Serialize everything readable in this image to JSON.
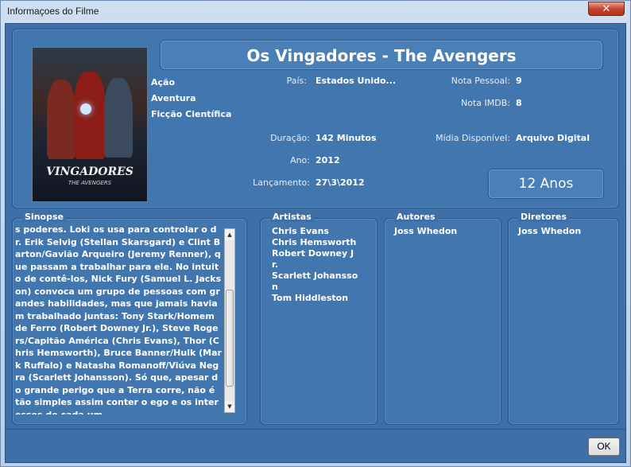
{
  "window": {
    "title": "Informaçoes do Filme",
    "close_glyph": "✕"
  },
  "poster": {
    "title": "VINGADORES",
    "subtitle": "THE AVENGERS"
  },
  "movie": {
    "title": "Os Vingadores - The Avengers"
  },
  "genres": [
    "Ação",
    "Aventura",
    "Ficção Científica"
  ],
  "info": {
    "pais_label": "País:",
    "pais_value": "Estados Unido...",
    "nota_pessoal_label": "Nota Pessoal:",
    "nota_pessoal_value": "9",
    "nota_imdb_label": "Nota IMDB:",
    "nota_imdb_value": "8",
    "duracao_label": "Duração:",
    "duracao_value": "142 Minutos",
    "midia_label": "Mídia Disponível:",
    "midia_value": "Arquivo Digital",
    "ano_label": "Ano:",
    "ano_value": "2012",
    "lancamento_label": "Lançamento:",
    "lancamento_value": "27\\3\\2012",
    "classificacao": "12 Anos"
  },
  "sinopse": {
    "label": "Sinopse",
    "text": "s poderes. Loki os usa para controlar o dr. Erik Selvig (Stellan Skarsgard) e Clint Barton/Gavião Arqueiro (Jeremy Renner), que passam a trabalhar para ele. No intuito de contê-los, Nick Fury (Samuel L. Jackson) convoca um grupo de pessoas com grandes habilidades, mas que jamais haviam trabalhado juntas: Tony Stark/Homem de Ferro (Robert Downey Jr.), Steve Rogers/Capitão América (Chris Evans), Thor (Chris Hemsworth), Bruce Banner/Hulk (Mark Ruffalo) e Natasha Romanoff/Viúva Negra (Scarlett Johansson). Só que, apesar do grande perigo que a Terra corre, não é tão simples assim conter o ego e os interesses de cada um"
  },
  "artistas": {
    "label": "Artistas",
    "items": [
      "Chris Evans",
      "Chris Hemsworth",
      "Robert Downey J",
      "r.",
      "Scarlett Johansso",
      "n",
      "Tom Hiddleston"
    ]
  },
  "autores": {
    "label": "Autores",
    "items": [
      "Joss Whedon"
    ]
  },
  "diretores": {
    "label": "Diretores",
    "items": [
      "Joss Whedon"
    ]
  },
  "buttons": {
    "ok": "OK"
  }
}
